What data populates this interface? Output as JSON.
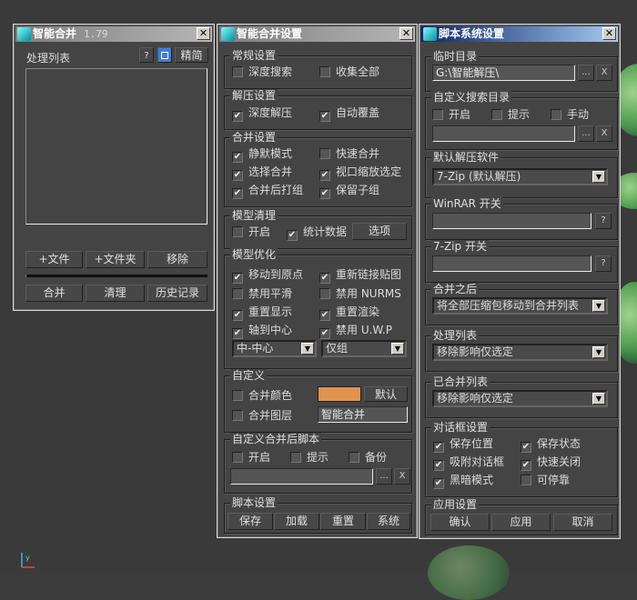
{
  "w1": {
    "title": "智能合并",
    "version": "1.79",
    "list_label": "处理列表",
    "help": "?",
    "compact": "精简",
    "add_file": "+文件",
    "add_folder": "+文件夹",
    "remove": "移除",
    "merge": "合并",
    "clean": "清理",
    "history": "历史记录"
  },
  "w2": {
    "title": "智能合并设置",
    "general": {
      "legend": "常规设置",
      "deep_search": "深度搜索",
      "collect_all": "收集全部"
    },
    "extract": {
      "legend": "解压设置",
      "deep_extract": "深度解压",
      "auto_overwrite": "自动覆盖"
    },
    "merge": {
      "legend": "合并设置",
      "silent": "静默模式",
      "quick": "快速合并",
      "select_merge": "选择合并",
      "zoom_sel": "视口缩放选定",
      "group_after": "合并后打组",
      "keep_sub": "保留子组"
    },
    "cleanup": {
      "legend": "模型清理",
      "enable": "开启",
      "stats": "统计数据",
      "options": "选项"
    },
    "optimize": {
      "legend": "模型优化",
      "to_origin": "移动到原点",
      "relink": "重新链接贴图",
      "no_smooth": "禁用平滑",
      "no_nurms": "禁用 NURMS",
      "reset_display": "重置显示",
      "reset_render": "重置渲染",
      "pivot_center": "轴到中心",
      "no_uwp": "禁用 U.W.P",
      "pivot_select": "中-中心",
      "scope_select": "仅组"
    },
    "custom": {
      "legend": "自定义",
      "merge_color": "合并颜色",
      "color": "#e0944e",
      "default": "默认",
      "merge_layer": "合并图层",
      "layer_name": "智能合并"
    },
    "post_script": {
      "legend": "自定义合并后脚本",
      "enable": "开启",
      "prompt": "提示",
      "backup": "备份",
      "browse": "...",
      "clear": "X"
    },
    "script": {
      "legend": "脚本设置",
      "save": "保存",
      "load": "加载",
      "reset": "重置",
      "system": "系统"
    }
  },
  "w3": {
    "title": "脚本系统设置",
    "temp": {
      "legend": "临时目录",
      "path": "G:\\智能解压\\",
      "browse": "...",
      "clear": "X"
    },
    "search": {
      "legend": "自定义搜索目录",
      "enable": "开启",
      "prompt": "提示",
      "manual": "手动",
      "browse": "...",
      "clear": "X"
    },
    "extractor": {
      "legend": "默认解压软件",
      "value": "7-Zip (默认解压)"
    },
    "winrar": {
      "legend": "WinRAR 开关",
      "help": "?"
    },
    "sevenzip": {
      "legend": "7-Zip 开关",
      "help": "?"
    },
    "after": {
      "legend": "合并之后",
      "value": "将全部压缩包移动到合并列表"
    },
    "proc": {
      "legend": "处理列表",
      "value": "移除影响仅选定"
    },
    "merged": {
      "legend": "已合并列表",
      "value": "移除影响仅选定"
    },
    "dialog": {
      "legend": "对话框设置",
      "save_pos": "保存位置",
      "save_state": "保存状态",
      "snap": "吸附对话框",
      "quick_close": "快速关闭",
      "dark": "黑暗模式",
      "dockable": "可停靠"
    },
    "apply": {
      "legend": "应用设置",
      "ok": "确认",
      "apply": "应用",
      "cancel": "取消"
    }
  }
}
